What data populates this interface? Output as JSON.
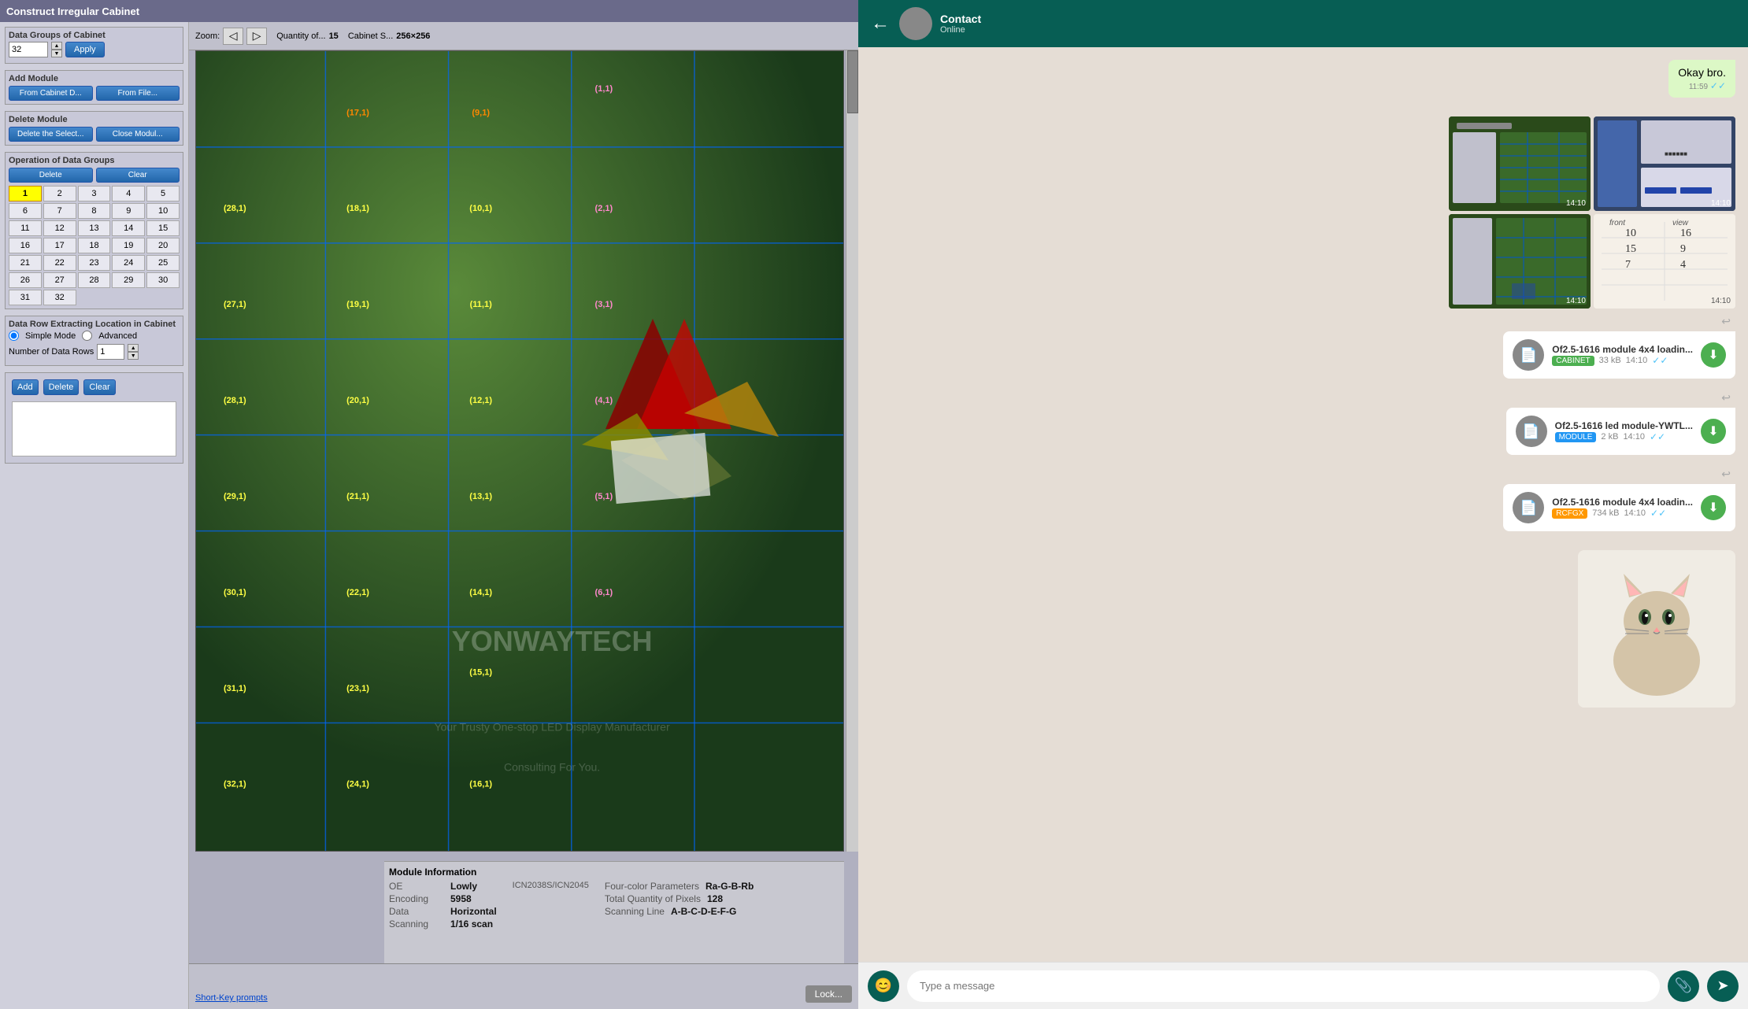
{
  "app": {
    "title": "Construct Irregular Cabinet"
  },
  "toolbar": {
    "zoom_label": "Zoom:",
    "quantity_label": "Quantity of...",
    "quantity_value": "15",
    "cabinet_size_label": "Cabinet S...",
    "cabinet_size_value": "256×256",
    "zoom_in": "▶",
    "zoom_out": "◀"
  },
  "sidebar": {
    "data_groups_label": "Data Groups of Cabinet",
    "data_groups_value": "32",
    "apply_btn": "Apply",
    "add_module_label": "Add Module",
    "from_cabinet_btn": "From Cabinet D...",
    "from_file_btn": "From File...",
    "delete_module_label": "Delete Module",
    "delete_by_select_btn": "Delete the Select...",
    "close_module_btn": "Close Modul...",
    "operation_label": "Operation of Data Groups",
    "delete_btn": "Delete",
    "clear_btn": "Clear",
    "numbers": [
      1,
      2,
      3,
      4,
      5,
      6,
      7,
      8,
      9,
      10,
      11,
      12,
      13,
      14,
      15,
      16,
      17,
      18,
      19,
      20,
      21,
      22,
      23,
      24,
      25,
      26,
      27,
      28,
      29,
      30,
      31,
      32
    ],
    "active_number": 1,
    "extract_label": "Data Row Extracting Location in Cabinet",
    "simple_mode": "Simple Mode",
    "advanced": "Advanced",
    "num_data_rows_label": "Number of Data Rows",
    "num_data_rows_value": "1",
    "add_btn": "Add",
    "delete_row_btn": "Delete",
    "clear_row_btn": "Clear",
    "shortcut_label": "Short-Key prompts"
  },
  "module_info": {
    "label": "Module Information",
    "oe_key": "OE",
    "oe_val": "Lowly",
    "oe_val2": "ICN2038S/ICN2045",
    "encoding_key": "Encoding",
    "encoding_val": "5958",
    "data_key": "Data",
    "data_val": "Horizontal",
    "scanning_key": "Scanning",
    "scanning_val": "1/16 scan",
    "four_color_key": "Four-color Parameters",
    "four_color_val": "Ra-G-B-Rb",
    "total_pixels_key": "Total Quantity of Pixels",
    "total_pixels_val": "128",
    "scanning_line_key": "Scanning Line",
    "scanning_line_val": "A-B-C-D-E-F-G"
  },
  "grid_labels": [
    {
      "text": "(17,1)",
      "col": 1,
      "row": 0,
      "color": "orange"
    },
    {
      "text": "(9,1)",
      "col": 2,
      "row": 0,
      "color": "orange"
    },
    {
      "text": "(1,1)",
      "col": 3,
      "row": 0,
      "color": "pink"
    },
    {
      "text": "(28,1)",
      "col": 0,
      "row": 1,
      "color": "yellow"
    },
    {
      "text": "(18,1)",
      "col": 1,
      "row": 1,
      "color": "yellow"
    },
    {
      "text": "(10,1)",
      "col": 2,
      "row": 1,
      "color": "yellow"
    },
    {
      "text": "(2,1)",
      "col": 3,
      "row": 1,
      "color": "pink"
    },
    {
      "text": "(27,1)",
      "col": 0,
      "row": 2,
      "color": "yellow"
    },
    {
      "text": "(19,1)",
      "col": 1,
      "row": 2,
      "color": "yellow"
    },
    {
      "text": "(11,1)",
      "col": 2,
      "row": 2,
      "color": "yellow"
    },
    {
      "text": "(3,1)",
      "col": 3,
      "row": 2,
      "color": "pink"
    },
    {
      "text": "(28,1)",
      "col": 0,
      "row": 3,
      "color": "yellow"
    },
    {
      "text": "(20,1)",
      "col": 1,
      "row": 3,
      "color": "yellow"
    },
    {
      "text": "(12,1)",
      "col": 2,
      "row": 3,
      "color": "yellow"
    },
    {
      "text": "(4,1)",
      "col": 3,
      "row": 3,
      "color": "pink"
    },
    {
      "text": "(29,1)",
      "col": 0,
      "row": 4,
      "color": "yellow"
    },
    {
      "text": "(21,1)",
      "col": 1,
      "row": 4,
      "color": "yellow"
    },
    {
      "text": "(13,1)",
      "col": 2,
      "row": 4,
      "color": "yellow"
    },
    {
      "text": "(5,1)",
      "col": 3,
      "row": 4,
      "color": "pink"
    },
    {
      "text": "(30,1)",
      "col": 0,
      "row": 5,
      "color": "yellow"
    },
    {
      "text": "(22,1)",
      "col": 1,
      "row": 5,
      "color": "yellow"
    },
    {
      "text": "(14,1)",
      "col": 2,
      "row": 5,
      "color": "yellow"
    },
    {
      "text": "(6,1)",
      "col": 3,
      "row": 5,
      "color": "pink"
    },
    {
      "text": "(31,1)",
      "col": 0,
      "row": 6,
      "color": "yellow"
    },
    {
      "text": "(23,1)",
      "col": 1,
      "row": 6,
      "color": "yellow"
    },
    {
      "text": "(15,1)",
      "col": 2,
      "row": 6,
      "color": "yellow"
    },
    {
      "text": "(32,1)",
      "col": 0,
      "row": 7,
      "color": "yellow"
    },
    {
      "text": "(24,1)",
      "col": 1,
      "row": 7,
      "color": "yellow"
    },
    {
      "text": "(16,1)",
      "col": 2,
      "row": 7,
      "color": "yellow"
    }
  ],
  "watermark": {
    "brand": "YONWAYTECH",
    "tagline": "Your Trusty One-stop LED Display Manufacturer",
    "tagline2": "Consulting For You."
  },
  "chat": {
    "message_text": "Okay bro.",
    "message_time": "11:59",
    "file1_name": "Of2.5-1616 module 4x4 loadin...",
    "file1_type": "CABINET",
    "file1_size": "33 kB",
    "file1_time": "14:10",
    "file2_name": "Of2.5-1616 led module-YWTL...",
    "file2_type": "MODULE",
    "file2_size": "2 kB",
    "file2_time": "14:10",
    "file3_name": "Of2.5-1616 module 4x4 loadin...",
    "file3_type": "RCFGX",
    "file3_size": "734 kB",
    "file3_time": "14:10",
    "media1_time": "14:10",
    "media2_time": "14:10",
    "media3_time": "14:10",
    "media4_time": "14:10"
  },
  "lock_btn": "Lock..."
}
